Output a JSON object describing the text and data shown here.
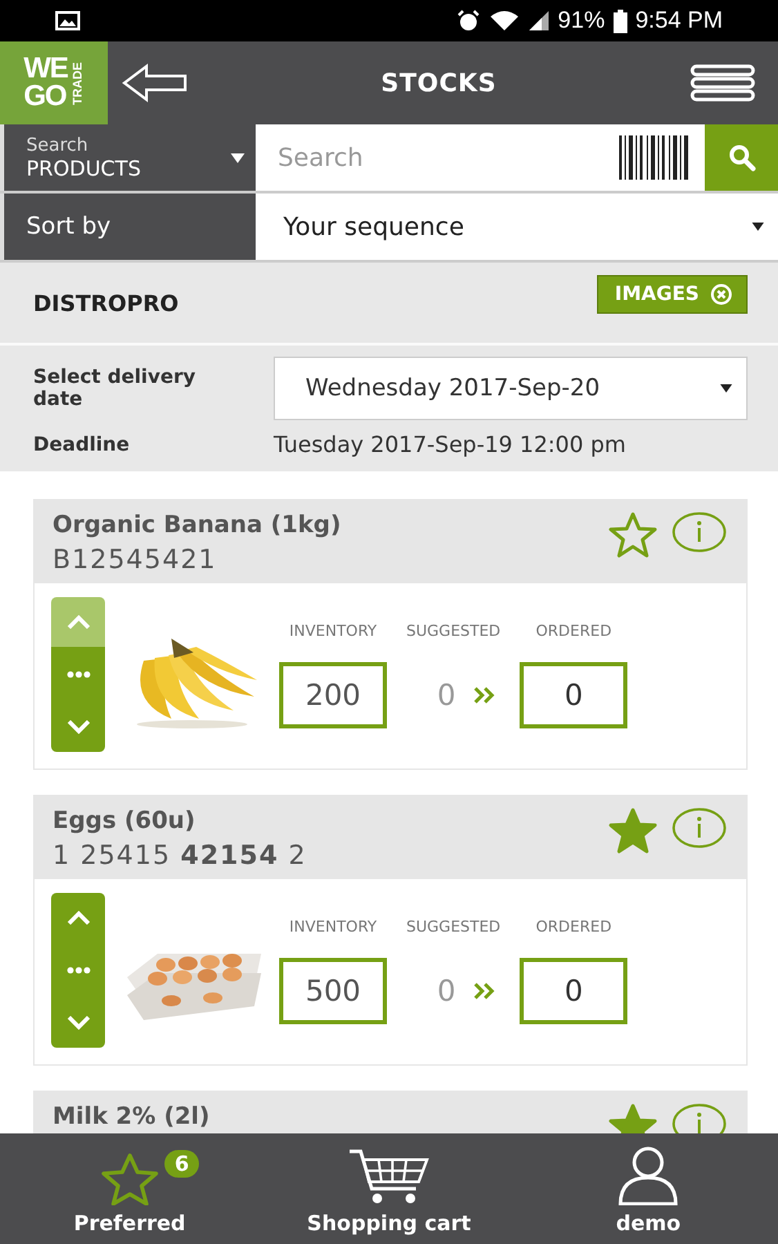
{
  "status_bar": {
    "battery": "91%",
    "time": "9:54 PM"
  },
  "header": {
    "logo": [
      "WE",
      "GO",
      "TRADE"
    ],
    "title": "STOCKS"
  },
  "search": {
    "scope_label": "Search",
    "scope": "PRODUCTS",
    "placeholder": "Search"
  },
  "sort": {
    "label": "Sort by",
    "value": "Your sequence"
  },
  "supplier": {
    "name": "DISTROPRO",
    "images_button": "IMAGES"
  },
  "delivery": {
    "label": "Select delivery date",
    "date": "Wednesday 2017-Sep-20",
    "deadline_label": "Deadline",
    "deadline": "Tuesday 2017-Sep-19 12:00 pm"
  },
  "products": [
    {
      "name": "Organic Banana (1kg)",
      "code": "B12545421",
      "favorite": false,
      "up_disabled": true,
      "columns": [
        "INVENTORY",
        "SUGGESTED",
        "ORDERED"
      ],
      "inventory": "200",
      "suggested": "0",
      "ordered": "0"
    },
    {
      "name": "Eggs (60u)",
      "code": "1 25415 **42154** 2",
      "favorite": true,
      "up_disabled": false,
      "columns": [
        "INVENTORY",
        "SUGGESTED",
        "ORDERED"
      ],
      "inventory": "500",
      "suggested": "0",
      "ordered": "0"
    },
    {
      "name": "Milk 2% (2l)",
      "favorite": true
    }
  ],
  "nav": [
    {
      "kind": "star",
      "label": "Preferred",
      "badge": "6"
    },
    {
      "kind": "cart",
      "label": "Shopping cart"
    },
    {
      "kind": "user",
      "label": "demo"
    }
  ]
}
